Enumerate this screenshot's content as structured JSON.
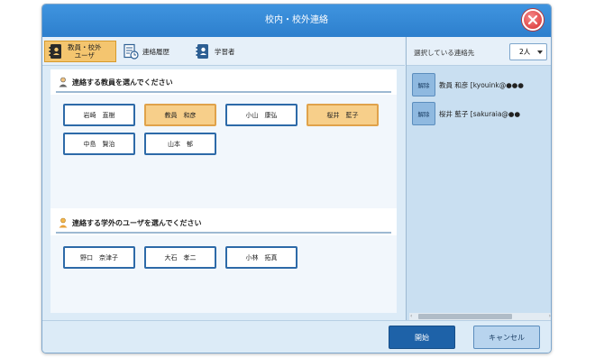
{
  "window": {
    "title": "校内・校外連絡"
  },
  "tabs": [
    {
      "label_line1": "教員・校外",
      "label_line2": "ユーザ",
      "icon": "address-book-icon",
      "active": true
    },
    {
      "label": "連絡履歴",
      "icon": "history-icon",
      "active": false
    },
    {
      "label": "学習者",
      "icon": "learner-icon",
      "active": false
    }
  ],
  "teachers_section": {
    "heading": "連絡する教員を選んでください",
    "icon": "teacher-person-icon",
    "items": [
      {
        "name": "岩崎　直樹",
        "selected": false
      },
      {
        "name": "教員　和彦",
        "selected": true
      },
      {
        "name": "小山　康弘",
        "selected": false
      },
      {
        "name": "桜井　藍子",
        "selected": true
      },
      {
        "name": "中島　賢治",
        "selected": false
      },
      {
        "name": "山本　郁",
        "selected": false
      }
    ]
  },
  "external_section": {
    "heading": "連絡する学外のユーザを選んでください",
    "icon": "external-user-icon",
    "items": [
      {
        "name": "野口　奈津子",
        "selected": false
      },
      {
        "name": "大石　孝二",
        "selected": false
      },
      {
        "name": "小林　拓真",
        "selected": false
      }
    ]
  },
  "selected_panel": {
    "title": "選択している連絡先",
    "count": "2人",
    "items": [
      {
        "remove_label": "解除",
        "text": "教員 和彦 [kyouink@●●●"
      },
      {
        "remove_label": "解除",
        "text": "桜井 藍子 [sakuraia@●●"
      }
    ]
  },
  "footer": {
    "start_label": "開始",
    "cancel_label": "キャンセル"
  },
  "colors": {
    "accent": "#2d7fcd",
    "selected_chip": "#f7cf8a",
    "start_button": "#1e62a8"
  }
}
